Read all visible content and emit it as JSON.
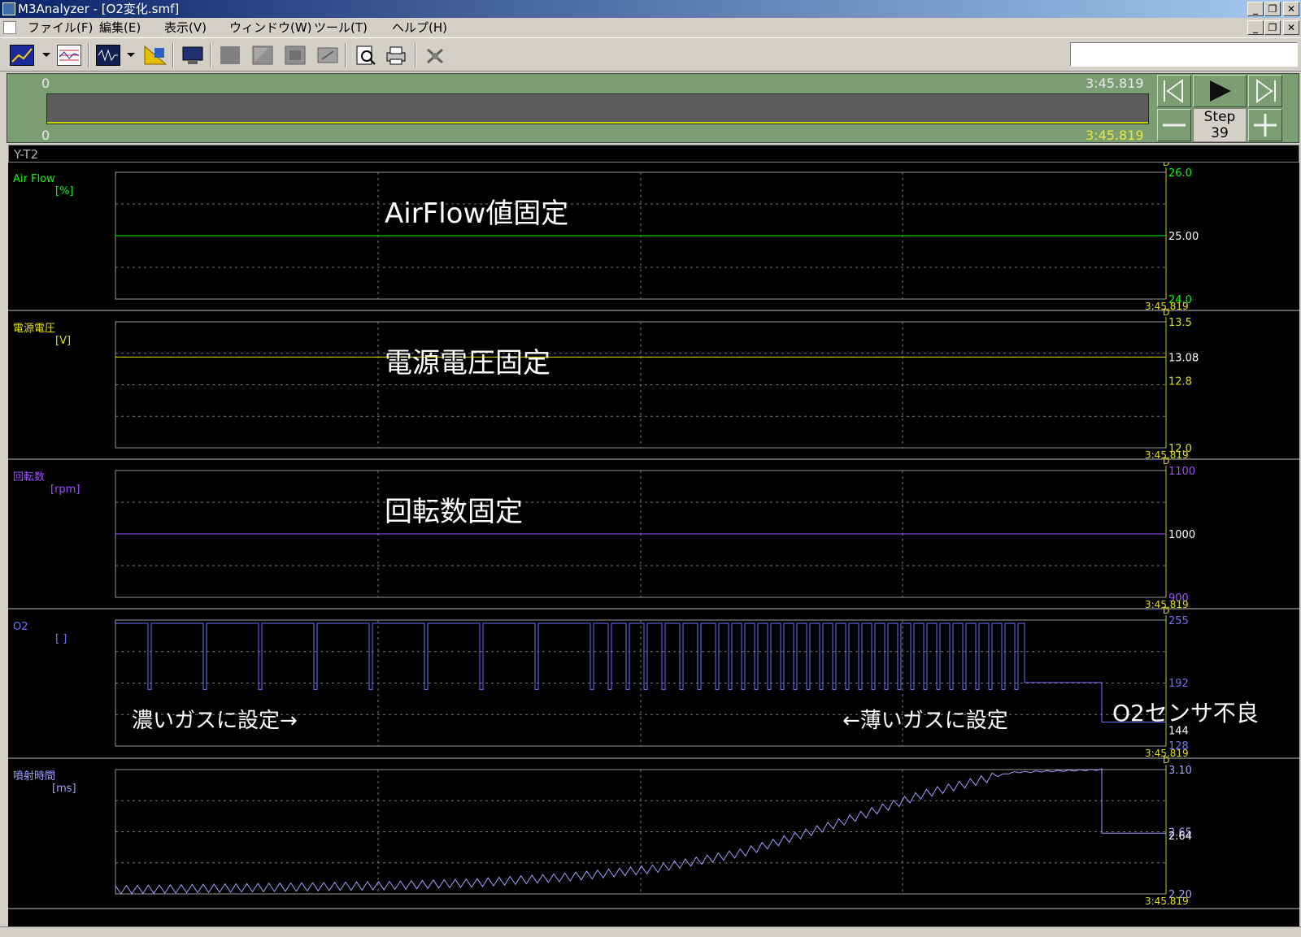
{
  "window": {
    "title": "M3Analyzer - [O2変化.smf]"
  },
  "menu": [
    "ファイル(F)",
    "編集(E)",
    "表示(V)",
    "ウィンドウ(W)",
    "ツール(T)",
    "ヘルプ(H)"
  ],
  "timeline": {
    "start_top": "0",
    "end_top": "3:45.819",
    "start_bottom": "0",
    "end_bottom": "3:45.819",
    "step_label": "Step",
    "step_value": "39"
  },
  "panel": {
    "title": "Y-T2"
  },
  "chart_data": [
    {
      "type": "line",
      "name": "Air Flow",
      "unit": "[%]",
      "color": "#00ff00",
      "y_ticks": [
        "26.0",
        "25.00",
        "24.0"
      ],
      "ylim": [
        24.0,
        26.0
      ],
      "cursor_value": "25.00",
      "end_time": "3:45.819",
      "annotation": "AirFlow値固定",
      "series": [
        {
          "values": [
            25.0,
            25.0
          ]
        }
      ]
    },
    {
      "type": "line",
      "name": "電源電圧",
      "unit": "[V]",
      "color": "#e0e000",
      "y_ticks": [
        "13.5",
        "13.08",
        "12.8",
        "12.0"
      ],
      "ylim": [
        12.0,
        13.5
      ],
      "cursor_value": "13.08",
      "end_time": "3:45.819",
      "annotation": "電源電圧固定",
      "series": [
        {
          "values": [
            13.08,
            13.08
          ]
        }
      ]
    },
    {
      "type": "line",
      "name": "回転数",
      "unit": "[rpm]",
      "color": "#a050ff",
      "y_ticks": [
        "1100",
        "1000",
        "900"
      ],
      "ylim": [
        900,
        1100
      ],
      "cursor_value": "1000",
      "end_time": "3:45.819",
      "annotation": "回転数固定",
      "series": [
        {
          "values": [
            1000,
            1000
          ]
        }
      ]
    },
    {
      "type": "line",
      "name": "O2",
      "unit": "[ ]",
      "color": "#7070ff",
      "y_ticks": [
        "255",
        "192",
        "144",
        "128"
      ],
      "ylim": [
        128,
        255
      ],
      "cursor_value": "144",
      "end_time": "3:45.819",
      "annotations": [
        "濃いガスに設定→",
        "←薄いガスに設定",
        "O2センサ不良"
      ],
      "series": [
        {
          "values": [
            255,
            185,
            255,
            185,
            255,
            185,
            255,
            185,
            255,
            185,
            255,
            185,
            255,
            185,
            255,
            185,
            255,
            185,
            255,
            185,
            255,
            192,
            192,
            144,
            144
          ]
        }
      ]
    },
    {
      "type": "line",
      "name": "噴射時間",
      "unit": "[ms]",
      "color": "#a0a0ff",
      "y_ticks": [
        "3.10",
        "2.65",
        "2.64",
        "2.20"
      ],
      "ylim": [
        2.2,
        3.1
      ],
      "cursor_value": "2.64",
      "end_time": "3:45.819",
      "series": [
        {
          "values": [
            2.23,
            2.24,
            2.25,
            2.26,
            2.28,
            2.32,
            2.38,
            2.5,
            2.7,
            2.92,
            3.08,
            3.1,
            3.1,
            2.64,
            2.64
          ]
        }
      ]
    }
  ]
}
